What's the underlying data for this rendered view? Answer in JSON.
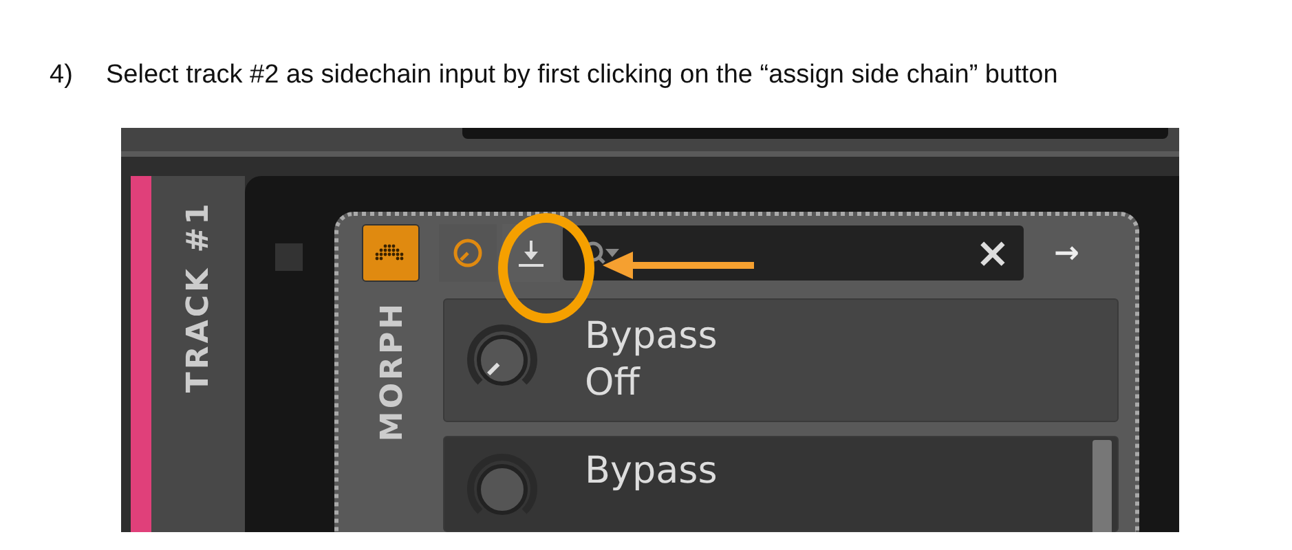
{
  "instruction": {
    "number": "4)",
    "text": "Select track #2 as sidechain input by first clicking on the “assign side chain” button"
  },
  "screenshot": {
    "track": {
      "name": "TRACK #1"
    },
    "device": {
      "name": "MORPH",
      "device_button_active": true,
      "clear_label": "×",
      "forward_label": "→",
      "parameters": [
        {
          "name": "Bypass",
          "value": "Off"
        },
        {
          "name": "Bypass"
        }
      ]
    }
  }
}
